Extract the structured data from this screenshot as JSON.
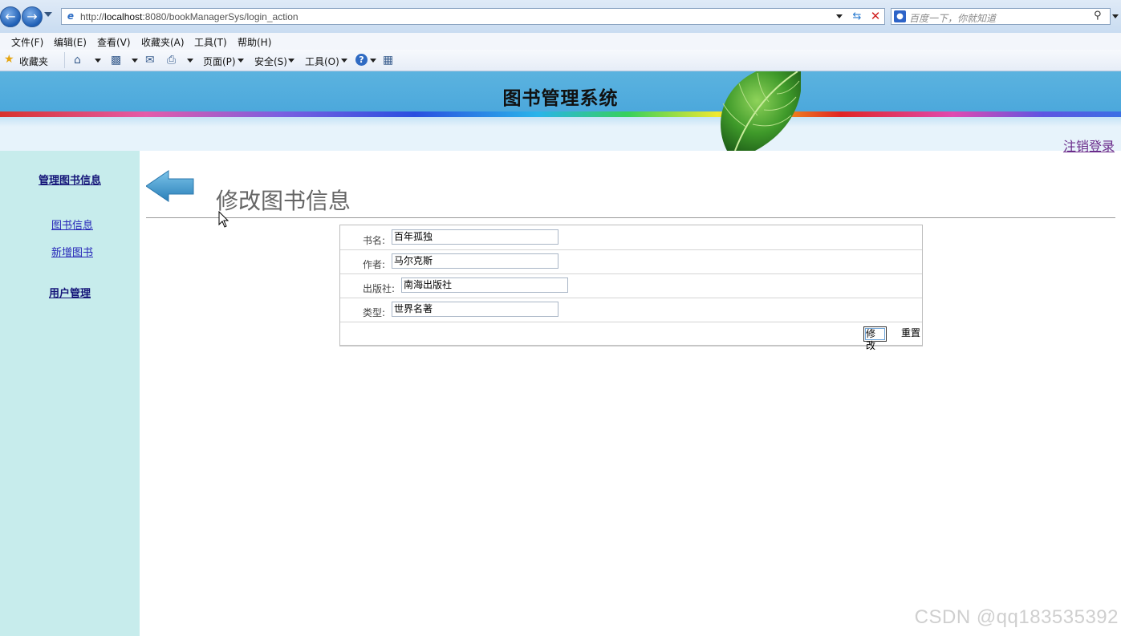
{
  "browser": {
    "url_prefix": "http://",
    "url_host": "localhost",
    "url_rest": ":8080/bookManagerSys/login_action",
    "search_placeholder": "百度一下，你就知道",
    "menu": [
      "文件(F)",
      "编辑(E)",
      "查看(V)",
      "收藏夹(A)",
      "工具(T)",
      "帮助(H)"
    ],
    "favorites_label": "收藏夹",
    "toolbar": {
      "page": "页面(P)",
      "safety": "安全(S)",
      "tools": "工具(O)"
    }
  },
  "header": {
    "title": "图书管理系统",
    "logout": "注销登录"
  },
  "sidebar": {
    "section_books": "管理图书信息",
    "link_book_info": "图书信息",
    "link_add_book": "新增图书",
    "section_users": "用户管理"
  },
  "main": {
    "title": "修改图书信息",
    "fields": {
      "name_label": "书名:",
      "name_value": "百年孤独",
      "author_label": "作者:",
      "author_value": "马尔克斯",
      "publisher_label": "出版社:",
      "publisher_value": "南海出版社",
      "type_label": "类型:",
      "type_value": "世界名著"
    },
    "buttons": {
      "modify": "修改",
      "reset": "重置"
    }
  },
  "watermark": "CSDN @qq183535392",
  "colors": {
    "banner_blue": "#4ca8dc",
    "sidebar_bg": "#c7ecec",
    "link": "#2626b8",
    "logout_link": "#6a2b8a"
  }
}
